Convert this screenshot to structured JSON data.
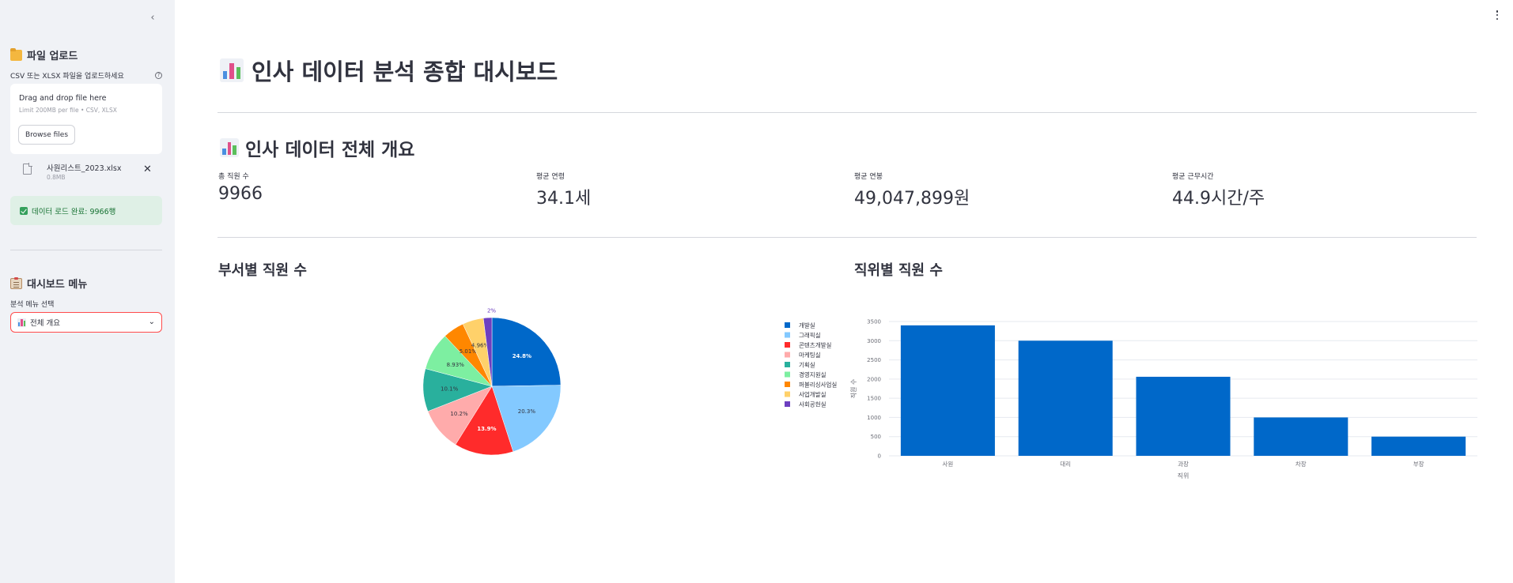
{
  "sidebar": {
    "upload_heading": "파일 업로드",
    "uploader_label": "CSV 또는 XLSX 파일을 업로드하세요",
    "dropzone_title": "Drag and drop file here",
    "dropzone_limit": "Limit 200MB per file • CSV, XLSX",
    "browse_label": "Browse files",
    "file_name": "사원리스트_2023.xlsx",
    "file_size": "0.8MB",
    "success_message": "데이터 로드 완료: 9966행",
    "menu_heading": "대시보드 메뉴",
    "select_label": "분석 메뉴 선택",
    "select_value": "전체 개요"
  },
  "main": {
    "title": "인사 데이터 분석 종합 대시보드",
    "overview_title": "인사 데이터 전체 개요",
    "metrics": [
      {
        "label": "총 직원 수",
        "value": "9966"
      },
      {
        "label": "평균 연령",
        "value": "34.1세"
      },
      {
        "label": "평균 연봉",
        "value": "49,047,899원"
      },
      {
        "label": "평균 근무시간",
        "value": "44.9시간/주"
      }
    ],
    "dept_chart_title": "부서별 직원 수",
    "position_chart_title": "직위별 직원 수"
  },
  "chart_data": [
    {
      "type": "pie",
      "title": "부서별 직원 수",
      "categories": [
        "개발실",
        "그래픽실",
        "콘텐츠개발실",
        "마케팅실",
        "기획실",
        "경영지원실",
        "퍼블리싱사업실",
        "사업개발실",
        "사회공헌실"
      ],
      "values": [
        24.8,
        20.3,
        13.9,
        10.2,
        10.1,
        8.93,
        5.01,
        4.96,
        2.0
      ],
      "value_labels": [
        "24.8%",
        "20.3%",
        "13.9%",
        "10.2%",
        "10.1%",
        "8.93%",
        "5.01%",
        "4.96%",
        "2%"
      ],
      "colors": [
        "#0068c9",
        "#83c9ff",
        "#ff2b2b",
        "#ffabab",
        "#29b09d",
        "#7defa1",
        "#ff8700",
        "#ffd16a",
        "#6d3fc0"
      ],
      "legend": "right"
    },
    {
      "type": "bar",
      "title": "직위별 직원 수",
      "categories": [
        "사원",
        "대리",
        "과장",
        "차장",
        "부장"
      ],
      "values": [
        3400,
        3000,
        2060,
        1000,
        500
      ],
      "xlabel": "직위",
      "ylabel": "직원 수",
      "yticks": [
        "0",
        "500",
        "1000",
        "1500",
        "2000",
        "2500",
        "3000",
        "3500"
      ],
      "ylim": [
        0,
        3500
      ],
      "color": "#0068c9",
      "grid": true
    }
  ]
}
